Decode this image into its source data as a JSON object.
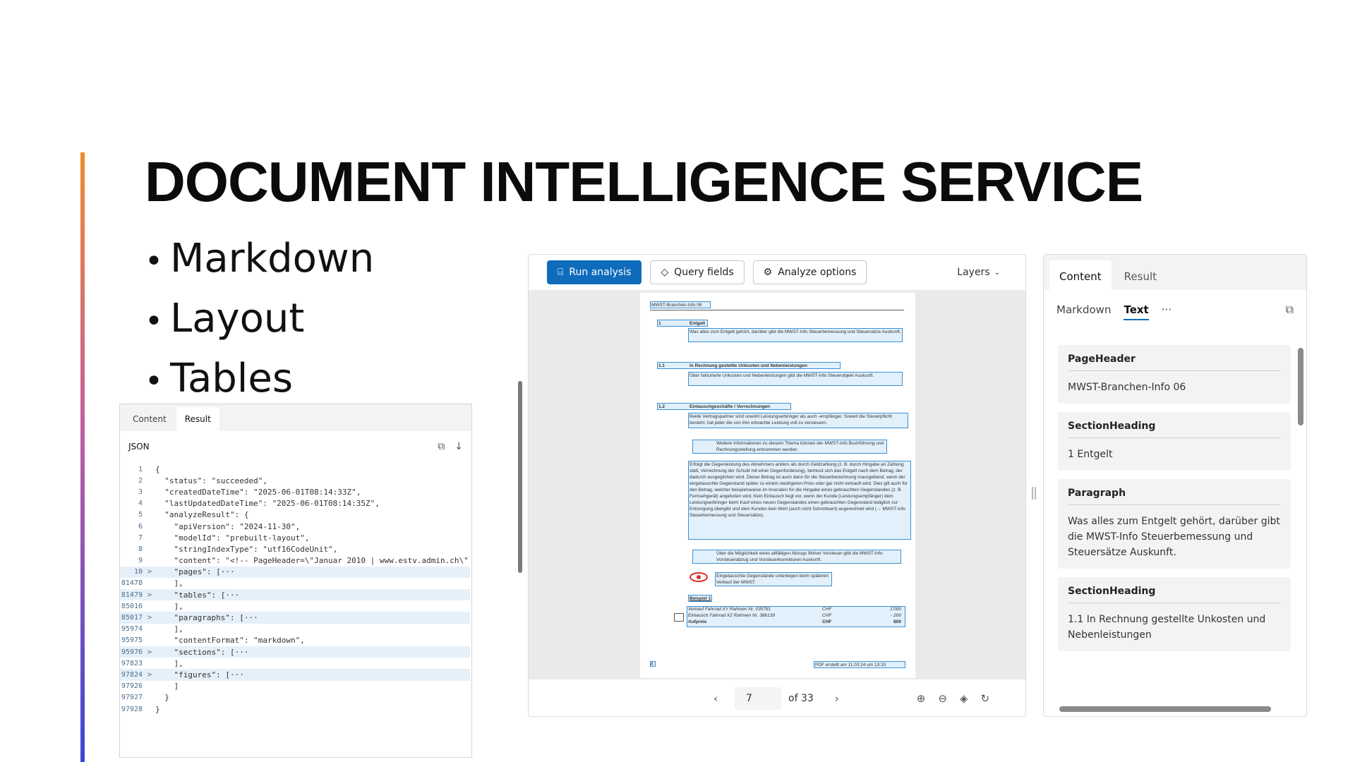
{
  "slide": {
    "title": "DOCUMENT INTELLIGENCE SERVICE",
    "bullets": [
      "Markdown",
      "Layout",
      "Tables"
    ]
  },
  "json_panel": {
    "tabs": [
      "Content",
      "Result"
    ],
    "active_tab": "Result",
    "header": "JSON",
    "lines": [
      {
        "num": "1",
        "text": "{",
        "fold": "",
        "hl": false
      },
      {
        "num": "2",
        "text": "  \"status\": \"succeeded\",",
        "fold": "",
        "hl": false
      },
      {
        "num": "3",
        "text": "  \"createdDateTime\": \"2025-06-01T08:14:33Z\",",
        "fold": "",
        "hl": false
      },
      {
        "num": "4",
        "text": "  \"lastUpdatedDateTime\": \"2025-06-01T08:14:35Z\",",
        "fold": "",
        "hl": false
      },
      {
        "num": "5",
        "text": "  \"analyzeResult\": {",
        "fold": "",
        "hl": false
      },
      {
        "num": "6",
        "text": "    \"apiVersion\": \"2024-11-30\",",
        "fold": "",
        "hl": false
      },
      {
        "num": "7",
        "text": "    \"modelId\": \"prebuilt-layout\",",
        "fold": "",
        "hl": false
      },
      {
        "num": "8",
        "text": "    \"stringIndexType\": \"utf16CodeUnit\",",
        "fold": "",
        "hl": false
      },
      {
        "num": "9",
        "text": "    \"content\": \"<!-- PageHeader=\\\"Januar 2010 | www.estv.admin.ch\\\"",
        "fold": "",
        "hl": false
      },
      {
        "num": "10",
        "text": "    \"pages\": [···",
        "fold": ">",
        "hl": true
      },
      {
        "num": "81478",
        "text": "    ],",
        "fold": "",
        "hl": false
      },
      {
        "num": "81479",
        "text": "    \"tables\": [···",
        "fold": ">",
        "hl": true
      },
      {
        "num": "85016",
        "text": "    ],",
        "fold": "",
        "hl": false
      },
      {
        "num": "85017",
        "text": "    \"paragraphs\": [···",
        "fold": ">",
        "hl": true
      },
      {
        "num": "95974",
        "text": "    ],",
        "fold": "",
        "hl": false
      },
      {
        "num": "95975",
        "text": "    \"contentFormat\": \"markdown\",",
        "fold": "",
        "hl": false
      },
      {
        "num": "95976",
        "text": "    \"sections\": [···",
        "fold": ">",
        "hl": true
      },
      {
        "num": "97823",
        "text": "    ],",
        "fold": "",
        "hl": false
      },
      {
        "num": "97824",
        "text": "    \"figures\": [···",
        "fold": ">",
        "hl": true
      },
      {
        "num": "97926",
        "text": "    ]",
        "fold": "",
        "hl": false
      },
      {
        "num": "97927",
        "text": "  }",
        "fold": "",
        "hl": false
      },
      {
        "num": "97928",
        "text": "}",
        "fold": "",
        "hl": false
      }
    ]
  },
  "viewer": {
    "run_label": "Run analysis",
    "query_label": "Query fields",
    "options_label": "Analyze options",
    "layers_label": "Layers",
    "page_current": "7",
    "page_total": "of 33",
    "doc": {
      "header": "MWST-Branchen-Info 06",
      "h1_num": "1",
      "h1": "Entgelt",
      "p1": "Was alles zum Entgelt gehört, darüber gibt die MWST-Info Steuerbemessung und Steuersätze Auskunft.",
      "h11_num": "1.1",
      "h11": "In Rechnung gestellte Unkosten und Nebenleistungen",
      "p11": "Über fakturierte Unkosten und Nebenleistungen gibt die MWST-Info Steuerobjekt Auskunft.",
      "h12_num": "1.2",
      "h12": "Eintauschgeschäfte / Verrechnungen",
      "p12": "Beide Vertragspartner sind sowohl Leistungserbringer als auch -empfänger. Soweit die Steuerpflicht besteht, hat jeder die von ihm erbrachte Leistung voll zu versteuern.",
      "note1": "Weitere Informationen zu diesem Thema können der MWST-Info Buchführung und Rechnungsstellung entnommen werden.",
      "p_long": "Erfolgt die Gegenleistung des Abnehmers anders als durch Geldzahlung (z. B. durch Hingabe an Zahlung statt, Verrechnung der Schuld mit einer Gegenforderung), bemisst sich das Entgelt nach dem Betrag, der dadurch ausgeglichen wird. Dieser Betrag ist auch dann für die Steuerberechnung massgebend, wenn der eingetauschte Gegenstand später zu einem niedrigeren Preis oder gar nicht verkauft wird. Dies gilt auch für den Betrag, welcher beispielsweise im Inseraten für die Hingabe eines gebrauchten Gegenstandes (z. B. Fernsehgerät) angeboten wird. Kein Eintausch liegt vor, wenn der Kunde (Leistungsempfänger) dem Leistungserbringer beim Kauf eines neuen Gegenstandes einen gebrauchten Gegenstand lediglich zur Entsorgung übergibt und dem Kunden kein Wert (auch nicht Schrottwert) angerechnet wird (→ MWST-Info Steuerbemessung und Steuersätze).",
      "note2": "Über die Möglichkeit eines allfälligen Abzugs fiktiver Vorsteuer gibt die MWST-Info Vorsteuerabzug und Vorsteuerkorrekturen Auskunft.",
      "note3": "Eingetauschte Gegenstände unterliegen beim späteren Verkauf der MWST.",
      "example": "Beispiel 1",
      "rows": [
        {
          "label": "Verkauf Fahrrad XY Rahmen Nr. 035781",
          "cur": "CHF",
          "amt": "1'000"
        },
        {
          "label": "Eintausch Fahrrad X2 Rahmen Nr. 386139",
          "cur": "CHF",
          "amt": "- 200"
        },
        {
          "label": "Aufpreis",
          "cur": "CHF",
          "amt": "800"
        }
      ],
      "footer_left": "8",
      "footer_right": "PDF erstellt am 11.03.24 um 13:33"
    }
  },
  "right_panel": {
    "tabs": [
      "Content",
      "Result"
    ],
    "active_tab": "Content",
    "subtabs": [
      "Markdown",
      "Text",
      "···"
    ],
    "active_subtab": "Text",
    "cards": [
      {
        "role": "PageHeader",
        "text": "MWST-Branchen-Info 06"
      },
      {
        "role": "SectionHeading",
        "text": "1 Entgelt"
      },
      {
        "role": "Paragraph",
        "text": "Was alles zum Entgelt gehört, darüber gibt die MWST-Info Steuerbemessung und Steuersätze Auskunft."
      },
      {
        "role": "SectionHeading",
        "text": "1.1 In Rechnung gestellte Unkosten und Nebenleistungen"
      }
    ]
  }
}
